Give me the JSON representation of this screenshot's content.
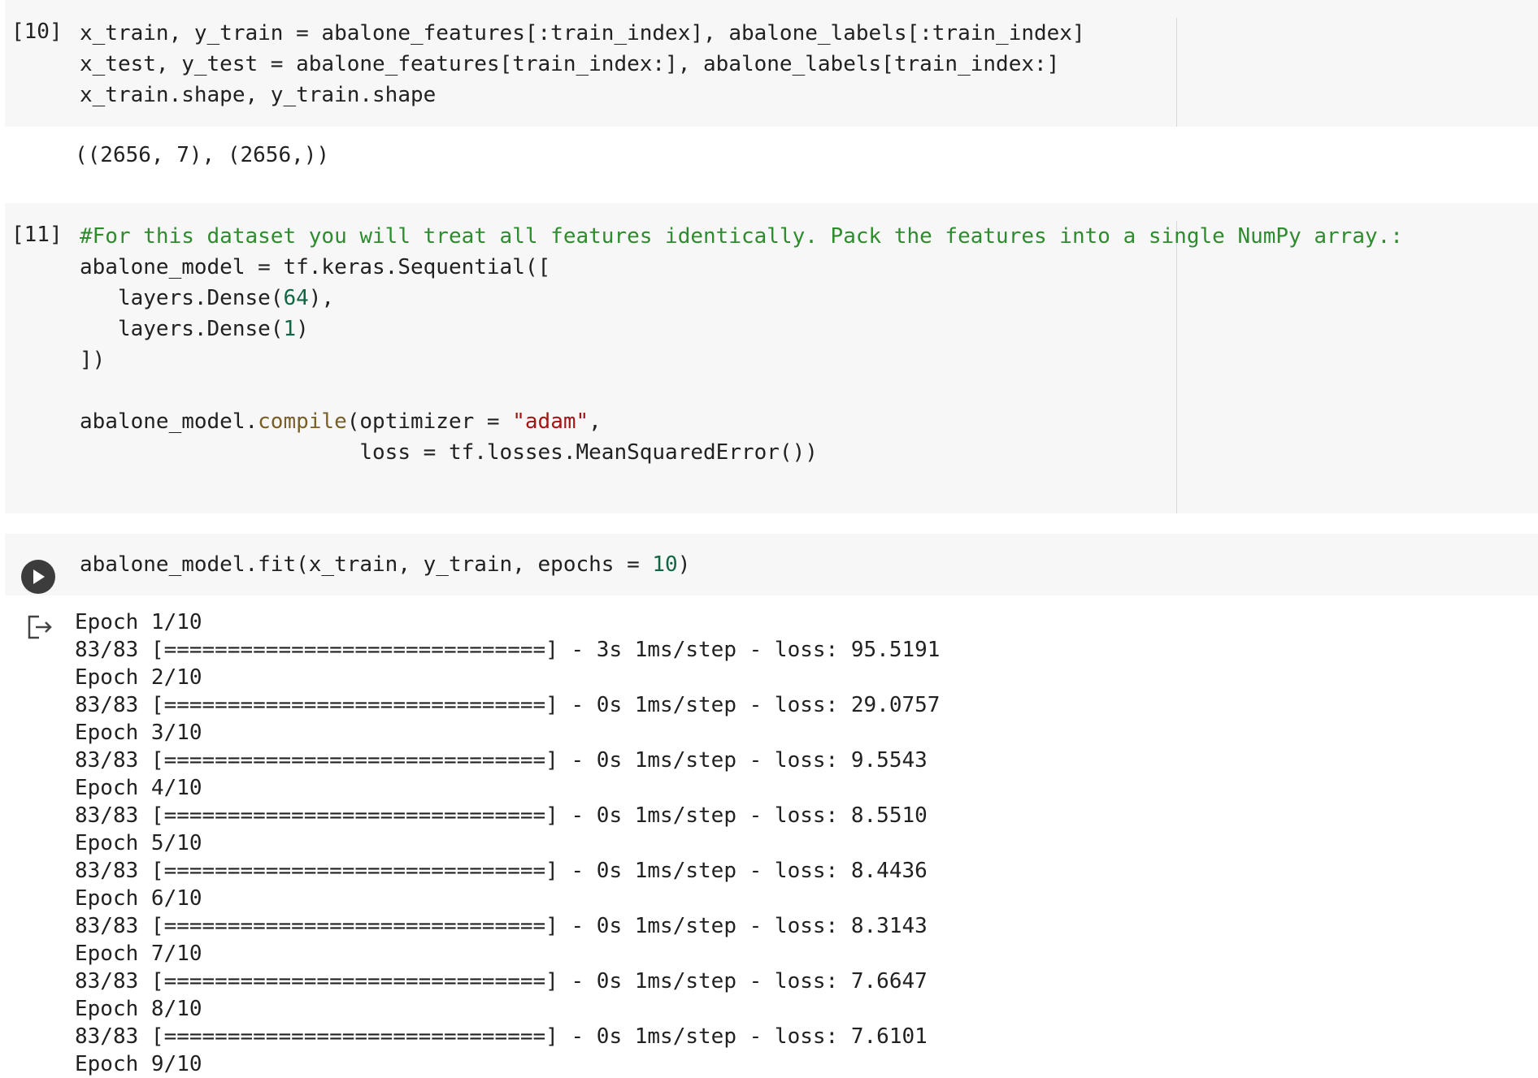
{
  "cell10": {
    "prompt": "[10]",
    "lines": [
      [
        {
          "t": "x_train, y_train = abalone_features[:train_index], abalone_labels[:train_index]",
          "c": ""
        }
      ],
      [
        {
          "t": "x_test, y_test = abalone_features[train_index:], abalone_labels[train_index:]",
          "c": ""
        }
      ],
      [
        {
          "t": "x_train.shape, y_train.shape",
          "c": ""
        }
      ]
    ],
    "output": "((2656, 7), (2656,))"
  },
  "cell11": {
    "prompt": "[11]",
    "lines": [
      [
        {
          "t": "#For this dataset you will treat all features identically. Pack the features into a single NumPy array.:",
          "c": "t-cmt"
        }
      ],
      [
        {
          "t": "abalone_model = tf.keras.Sequential([",
          "c": ""
        }
      ],
      [
        {
          "t": "   layers.Dense(",
          "c": ""
        },
        {
          "t": "64",
          "c": "t-num"
        },
        {
          "t": "),",
          "c": ""
        }
      ],
      [
        {
          "t": "   layers.Dense(",
          "c": ""
        },
        {
          "t": "1",
          "c": "t-num"
        },
        {
          "t": ")",
          "c": ""
        }
      ],
      [
        {
          "t": "])",
          "c": ""
        }
      ],
      [
        {
          "t": "",
          "c": ""
        }
      ],
      [
        {
          "t": "abalone_model.",
          "c": ""
        },
        {
          "t": "compile",
          "c": "t-fn"
        },
        {
          "t": "(optimizer = ",
          "c": ""
        },
        {
          "t": "\"adam\"",
          "c": "t-str"
        },
        {
          "t": ",",
          "c": ""
        }
      ],
      [
        {
          "t": "                      loss = tf.losses.MeanSquaredError())",
          "c": ""
        }
      ]
    ]
  },
  "cell12": {
    "lines": [
      [
        {
          "t": "abalone_model.fit(x_train, y_train, epochs = ",
          "c": ""
        },
        {
          "t": "10",
          "c": "t-num"
        },
        {
          "t": ")",
          "c": ""
        }
      ]
    ],
    "output": [
      "Epoch 1/10",
      "83/83 [==============================] - 3s 1ms/step - loss: 95.5191",
      "Epoch 2/10",
      "83/83 [==============================] - 0s 1ms/step - loss: 29.0757",
      "Epoch 3/10",
      "83/83 [==============================] - 0s 1ms/step - loss: 9.5543",
      "Epoch 4/10",
      "83/83 [==============================] - 0s 1ms/step - loss: 8.5510",
      "Epoch 5/10",
      "83/83 [==============================] - 0s 1ms/step - loss: 8.4436",
      "Epoch 6/10",
      "83/83 [==============================] - 0s 1ms/step - loss: 8.3143",
      "Epoch 7/10",
      "83/83 [==============================] - 0s 1ms/step - loss: 7.6647",
      "Epoch 8/10",
      "83/83 [==============================] - 0s 1ms/step - loss: 7.6101",
      "Epoch 9/10"
    ]
  },
  "icons": {
    "run": "play-icon",
    "output": "output-arrow-icon"
  }
}
